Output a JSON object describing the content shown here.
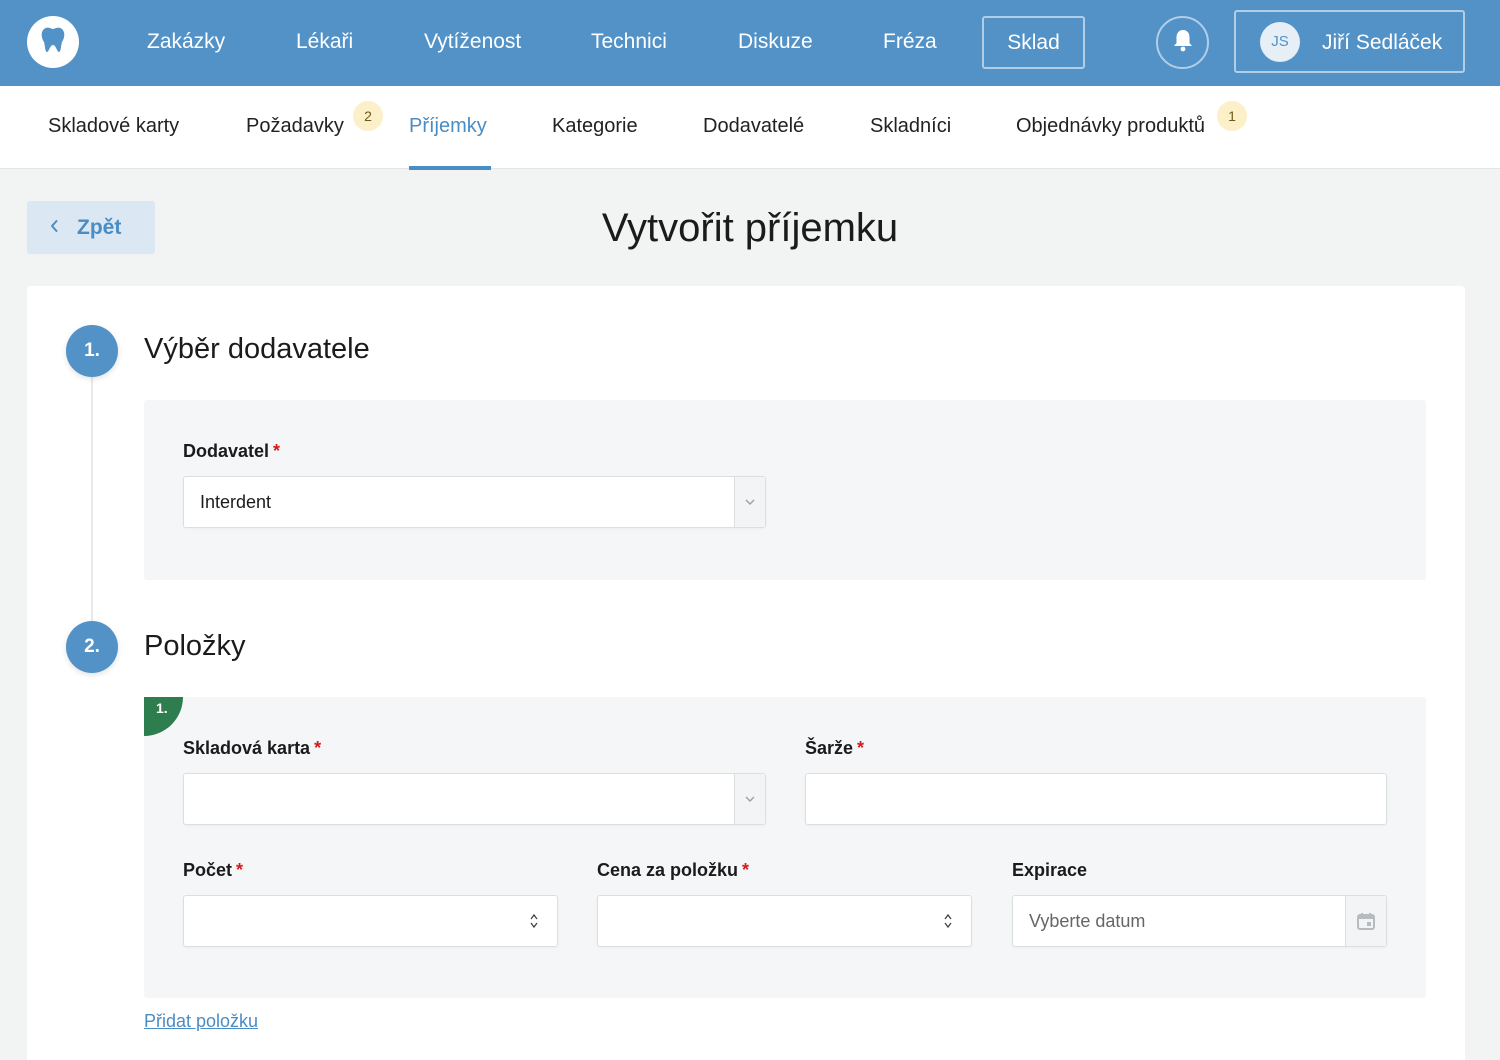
{
  "topbar": {
    "logo_icon": "tooth-icon",
    "nav": [
      "Zakázky",
      "Lékaři",
      "Vytíženost",
      "Technici",
      "Diskuze",
      "Fréza"
    ],
    "active_button": "Sklad",
    "bell_icon": "bell-icon",
    "user": {
      "initials": "JS",
      "name": "Jiří Sedláček"
    }
  },
  "subnav": {
    "items": [
      "Skladové karty",
      "Požadavky",
      "Příjemky",
      "Kategorie",
      "Dodavatelé",
      "Skladníci",
      "Objednávky produktů"
    ],
    "active": "Příjemky",
    "badges": {
      "pozadavky": "2",
      "objednavky": "1"
    }
  },
  "header": {
    "back_label": "Zpět",
    "back_icon": "chevron-left-icon",
    "title": "Vytvořit příjemku"
  },
  "step1": {
    "number": "1.",
    "title": "Výběr dodavatele",
    "supplier_label": "Dodavatel",
    "supplier_value": "Interdent"
  },
  "step2": {
    "number": "2.",
    "title": "Položky",
    "item_number": "1.",
    "card_label": "Skladová karta",
    "card_value": "",
    "batch_label": "Šarže",
    "batch_value": "",
    "count_label": "Počet",
    "count_value": "",
    "price_label": "Cena za položku",
    "price_value": "",
    "expiry_label": "Expirace",
    "expiry_placeholder": "Vyberte datum",
    "calendar_icon": "calendar-icon",
    "add_item": "Přidat položku"
  },
  "required_mark": "*",
  "colors": {
    "primary": "#5392c7",
    "link": "#4a8cc4",
    "required": "#d21c1c",
    "item_marker": "#2e7d4f",
    "badge": "#fcf0c9"
  }
}
